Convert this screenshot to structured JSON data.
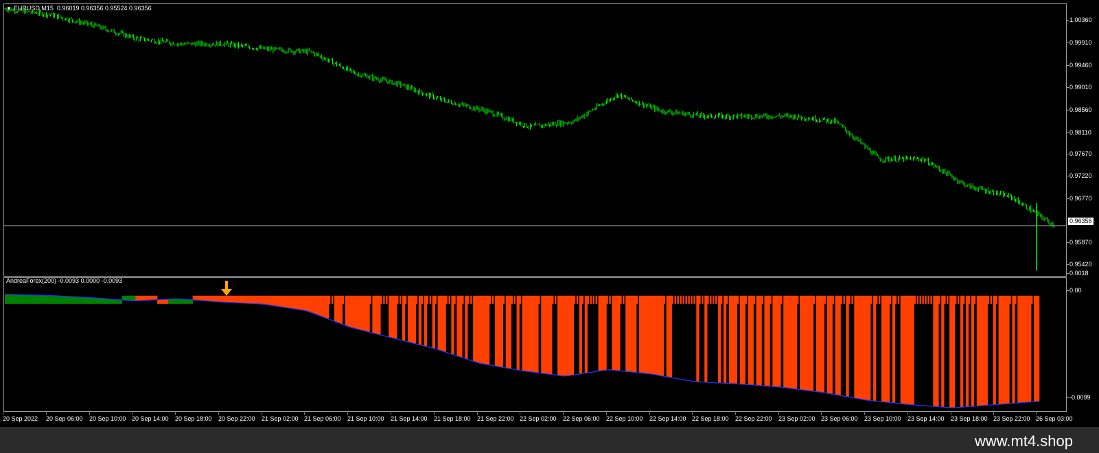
{
  "main_chart": {
    "symbol_label": "EURUSD,M15",
    "ohlc_text": "0.96019 0.96356 0.95524 0.96356",
    "collapse_icon": "triangle-down-icon",
    "current_price": "0.96356",
    "price_ticks": [
      "1.00360",
      "0.99910",
      "0.99460",
      "0.99010",
      "0.98560",
      "0.98110",
      "0.97670",
      "0.97220",
      "0.96770",
      "0.95870",
      "0.95420"
    ],
    "colors": {
      "candle": "#00ff00",
      "background": "#000000",
      "grid_line": "#c0c0c0"
    }
  },
  "indicator": {
    "label": "AndreaForex(200) -0.0093 0.0000 -0.0093",
    "ticks": [
      "0.0018",
      "0.00",
      "-0.0099"
    ],
    "arrow_icon": "arrow-down-icon",
    "colors": {
      "bullish": "#008000",
      "bearish": "#ff4000",
      "line": "#2030ff",
      "arrow": "#ffa500"
    }
  },
  "time_axis": [
    "20 Sep 2022",
    "20 Sep 06:00",
    "20 Sep 10:00",
    "20 Sep 14:00",
    "20 Sep 18:00",
    "20 Sep 22:00",
    "21 Sep 02:00",
    "21 Sep 06:00",
    "21 Sep 10:00",
    "21 Sep 14:00",
    "21 Sep 18:00",
    "21 Sep 22:00",
    "22 Sep 02:00",
    "22 Sep 06:00",
    "22 Sep 10:00",
    "22 Sep 14:00",
    "22 Sep 18:00",
    "22 Sep 22:00",
    "23 Sep 02:00",
    "23 Sep 06:00",
    "23 Sep 10:00",
    "23 Sep 14:00",
    "23 Sep 18:00",
    "23 Sep 22:00",
    "26 Sep 03:00"
  ],
  "chart_data": {
    "type": "line",
    "title": "EURUSD,M15",
    "ylim": [
      0.9542,
      1.0049
    ],
    "x": [
      "20 Sep 2022",
      "20 Sep 06:00",
      "20 Sep 10:00",
      "20 Sep 14:00",
      "20 Sep 18:00",
      "20 Sep 22:00",
      "21 Sep 02:00",
      "21 Sep 06:00",
      "21 Sep 10:00",
      "21 Sep 14:00",
      "21 Sep 18:00",
      "21 Sep 22:00",
      "22 Sep 02:00",
      "22 Sep 06:00",
      "22 Sep 10:00",
      "22 Sep 14:00",
      "22 Sep 18:00",
      "22 Sep 22:00",
      "23 Sep 02:00",
      "23 Sep 06:00",
      "23 Sep 10:00",
      "23 Sep 14:00",
      "23 Sep 18:00",
      "23 Sep 22:00",
      "26 Sep 03:00"
    ],
    "series": [
      {
        "name": "EURUSD,M15",
        "values": [
          1.004,
          1.003,
          1.001,
          0.9985,
          0.9975,
          0.9975,
          0.9965,
          0.996,
          0.992,
          0.99,
          0.987,
          0.985,
          0.982,
          0.983,
          0.988,
          0.985,
          0.984,
          0.984,
          0.984,
          0.983,
          0.976,
          0.976,
          0.971,
          0.969,
          0.9636
        ]
      },
      {
        "name": "AndreaForex(200)",
        "values": [
          0.0005,
          0.0004,
          0.0002,
          -0.0001,
          0.0001,
          -0.0002,
          -0.0004,
          -0.001,
          -0.0025,
          -0.0035,
          -0.0045,
          -0.0058,
          -0.0065,
          -0.007,
          -0.0064,
          -0.0068,
          -0.0075,
          -0.0077,
          -0.008,
          -0.0085,
          -0.0092,
          -0.0096,
          -0.0099,
          -0.0096,
          -0.0093
        ]
      }
    ]
  },
  "footer": {
    "watermark": "www.mt4.shop"
  }
}
